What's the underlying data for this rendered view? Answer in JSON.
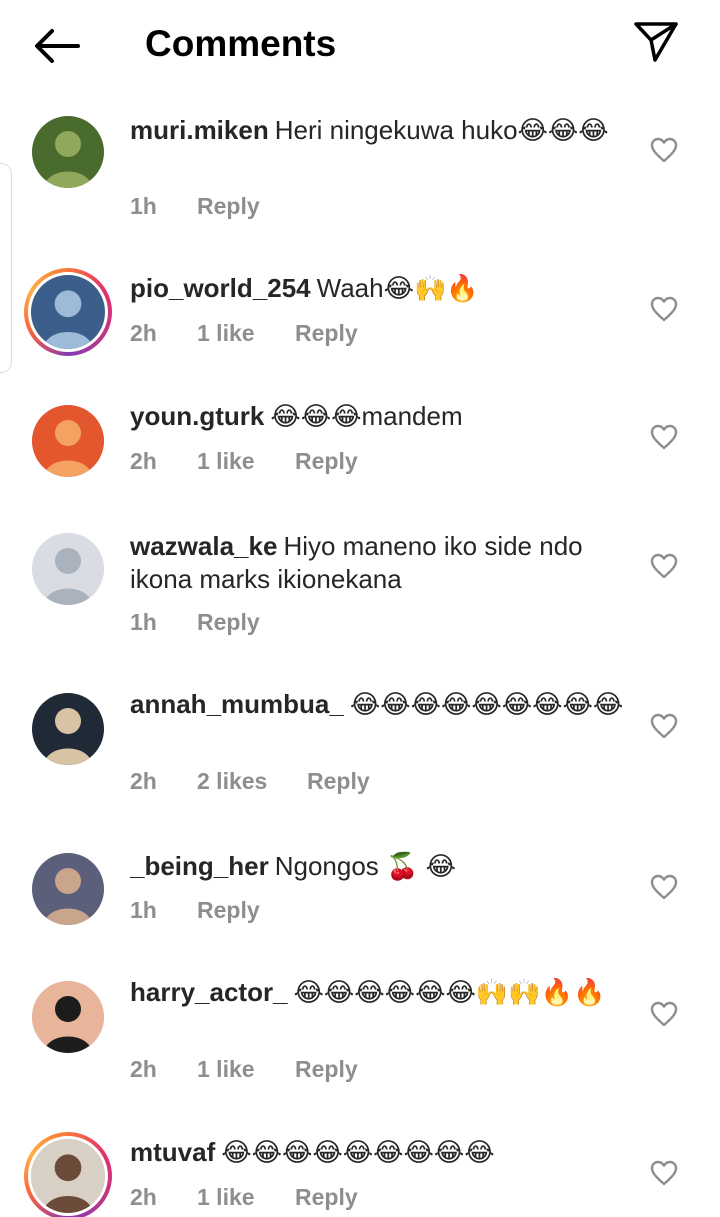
{
  "header": {
    "title": "Comments",
    "back_icon": "arrow-left-icon",
    "send_icon": "paper-plane-icon"
  },
  "comments": [
    {
      "username": "muri.miken",
      "text": "Heri ningekuwa huko😂😂😂",
      "time": "1h",
      "likes": "",
      "reply": "Reply",
      "ring": false,
      "avatar_colors": [
        "#4a6b2e",
        "#8fa85c"
      ]
    },
    {
      "username": "pio_world_254",
      "text": "Waah😂🙌🔥",
      "time": "2h",
      "likes": "1 like",
      "reply": "Reply",
      "ring": true,
      "avatar_colors": [
        "#3b5f8a",
        "#9dbbd8"
      ]
    },
    {
      "username": "youn.gturk",
      "text": "😂😂😂mandem",
      "time": "2h",
      "likes": "1 like",
      "reply": "Reply",
      "ring": false,
      "avatar_colors": [
        "#e4572e",
        "#f4a261"
      ]
    },
    {
      "username": "wazwala_ke",
      "text": "Hiyo maneno iko side ndo ikona marks ikionekana",
      "time": "1h",
      "likes": "",
      "reply": "Reply",
      "ring": false,
      "avatar_colors": [
        "#d9dde3",
        "#aab2bd"
      ]
    },
    {
      "username": "annah_mumbua_",
      "text": "😂😂😂😂😂😂😂😂😂",
      "time": "2h",
      "likes": "2 likes",
      "reply": "Reply",
      "ring": false,
      "avatar_colors": [
        "#1f2a36",
        "#d9c3a5"
      ]
    },
    {
      "username": "_being_her",
      "text": "Ngongos 🍒 😂",
      "time": "1h",
      "likes": "",
      "reply": "Reply",
      "ring": false,
      "avatar_colors": [
        "#5b5f7a",
        "#c9a58c"
      ]
    },
    {
      "username": "harry_actor_",
      "text": "😂😂😂😂😂😂🙌🙌🔥🔥",
      "time": "2h",
      "likes": "1 like",
      "reply": "Reply",
      "ring": false,
      "avatar_colors": [
        "#e8b49a",
        "#1c1c1c"
      ]
    },
    {
      "username": "mtuvaf",
      "text": "😂😂😂😂😂😂😂😂😂",
      "time": "2h",
      "likes": "1 like",
      "reply": "Reply",
      "ring": true,
      "avatar_colors": [
        "#d8d0c4",
        "#6b4a3a"
      ]
    }
  ]
}
